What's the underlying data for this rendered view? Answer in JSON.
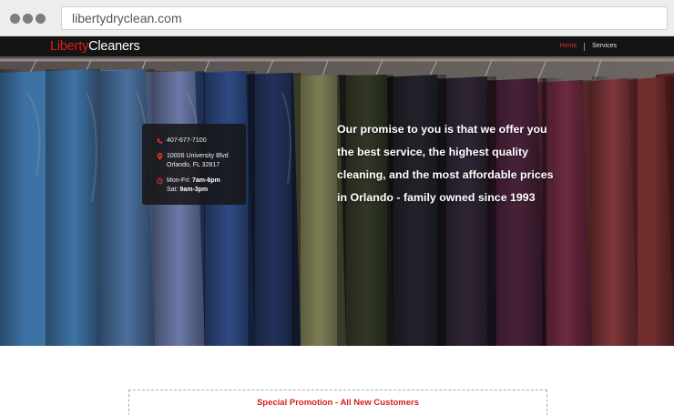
{
  "browser": {
    "url": "libertydryclean.com"
  },
  "nav": {
    "logo_part1": "Liberty",
    "logo_part2": "Cleaners",
    "links": [
      {
        "label": "Home",
        "active": true
      },
      {
        "label": "Services",
        "active": false
      }
    ]
  },
  "contact": {
    "phone": "407-677-7100",
    "address_line1": "10006 University Blvd",
    "address_line2": "Orlando, FL 32817",
    "hours_weekday_label": "Mon-Fri: ",
    "hours_weekday_value": "7am-6pm",
    "hours_saturday_label": "Sat: ",
    "hours_saturday_value": "9am-3pm"
  },
  "hero": {
    "promise_lines": [
      "Our promise to you is that we offer you",
      "the best service, the highest quality",
      "cleaning, and the most affordable prices",
      "in Orlando - family owned since 1993"
    ]
  },
  "promo": {
    "title": "Special Promotion - All New Customers"
  },
  "colors": {
    "brand_red": "#e21a1a",
    "nav_bg": "#141414",
    "promo_red": "#d81f1f"
  },
  "icons": {
    "phone": "phone-icon",
    "location": "location-pin-icon",
    "hours": "clock-icon"
  }
}
